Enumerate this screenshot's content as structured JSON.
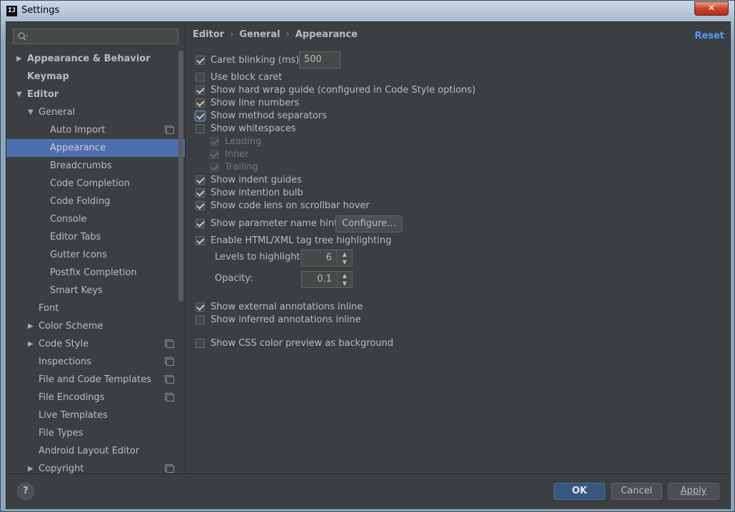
{
  "window": {
    "title": "Settings",
    "app_icon": "IJ",
    "close_glyph": "✕"
  },
  "search": {
    "placeholder": "",
    "value": ""
  },
  "tree": [
    {
      "label": "Appearance & Behavior",
      "bold": true,
      "arrow": "▶",
      "depth": 0
    },
    {
      "label": "Keymap",
      "bold": true,
      "arrow": "",
      "depth": 0
    },
    {
      "label": "Editor",
      "bold": true,
      "arrow": "▼",
      "depth": 0
    },
    {
      "label": "General",
      "bold": false,
      "arrow": "▼",
      "depth": 1
    },
    {
      "label": "Auto Import",
      "depth": 2,
      "copy": true
    },
    {
      "label": "Appearance",
      "depth": 2,
      "selected": true
    },
    {
      "label": "Breadcrumbs",
      "depth": 2
    },
    {
      "label": "Code Completion",
      "depth": 2
    },
    {
      "label": "Code Folding",
      "depth": 2
    },
    {
      "label": "Console",
      "depth": 2
    },
    {
      "label": "Editor Tabs",
      "depth": 2
    },
    {
      "label": "Gutter Icons",
      "depth": 2
    },
    {
      "label": "Postfix Completion",
      "depth": 2
    },
    {
      "label": "Smart Keys",
      "depth": 2
    },
    {
      "label": "Font",
      "depth": 1
    },
    {
      "label": "Color Scheme",
      "depth": 1,
      "arrow": "▶"
    },
    {
      "label": "Code Style",
      "depth": 1,
      "arrow": "▶",
      "copy": true
    },
    {
      "label": "Inspections",
      "depth": 1,
      "copy": true
    },
    {
      "label": "File and Code Templates",
      "depth": 1,
      "copy": true
    },
    {
      "label": "File Encodings",
      "depth": 1,
      "copy": true
    },
    {
      "label": "Live Templates",
      "depth": 1
    },
    {
      "label": "File Types",
      "depth": 1
    },
    {
      "label": "Android Layout Editor",
      "depth": 1
    },
    {
      "label": "Copyright",
      "depth": 1,
      "arrow": "▶",
      "copy": true
    }
  ],
  "breadcrumb": {
    "part1": "Editor",
    "part2": "General",
    "part3": "Appearance",
    "sep": "›"
  },
  "reset_label": "Reset",
  "options": {
    "caret_blinking": {
      "label": "Caret blinking (ms):",
      "checked": true,
      "value": "500"
    },
    "block_caret": {
      "label": "Use block caret",
      "checked": false
    },
    "hard_wrap": {
      "label": "Show hard wrap guide (configured in Code Style options)",
      "checked": true
    },
    "line_numbers": {
      "label": "Show line numbers",
      "checked": true
    },
    "method_separators": {
      "label": "Show method separators",
      "checked": true
    },
    "whitespaces": {
      "label": "Show whitespaces",
      "checked": false
    },
    "leading": {
      "label": "Leading",
      "checked": true
    },
    "inner": {
      "label": "Inner",
      "checked": true
    },
    "trailing": {
      "label": "Trailing",
      "checked": true
    },
    "indent_guides": {
      "label": "Show indent guides",
      "checked": true
    },
    "intention_bulb": {
      "label": "Show intention bulb",
      "checked": true
    },
    "code_lens": {
      "label": "Show code lens on scrollbar hover",
      "checked": true
    },
    "param_hints": {
      "label": "Show parameter name hints",
      "checked": true,
      "button": "Configure..."
    },
    "tag_tree": {
      "label": "Enable HTML/XML tag tree highlighting",
      "checked": true
    },
    "levels": {
      "label": "Levels to highlight:",
      "value": "6"
    },
    "opacity": {
      "label": "Opacity:",
      "value": "0.1"
    },
    "ext_annotations": {
      "label": "Show external annotations inline",
      "checked": true
    },
    "inferred_annotations": {
      "label": "Show inferred annotations inline",
      "checked": false
    },
    "css_preview": {
      "label": "Show CSS color preview as background",
      "checked": false
    }
  },
  "footer": {
    "help": "?",
    "ok": "OK",
    "cancel": "Cancel",
    "apply": "Apply"
  },
  "colors": {
    "background": "#3c3f41",
    "selection": "#4b6eaf",
    "link": "#589df6",
    "ok_button": "#365880"
  }
}
